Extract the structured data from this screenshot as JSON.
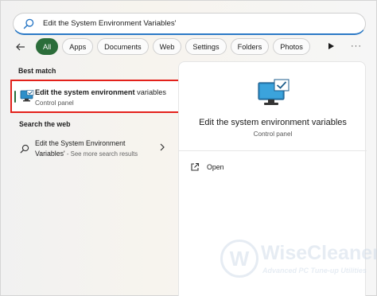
{
  "search": {
    "query": "Edit the System Environment Variables'"
  },
  "filters": {
    "items": [
      "All",
      "Apps",
      "Documents",
      "Web",
      "Settings",
      "Folders",
      "Photos"
    ],
    "active": "All"
  },
  "sections": {
    "best_match_label": "Best match",
    "search_web_label": "Search the web"
  },
  "best_match": {
    "title_bold": "Edit the system environment",
    "title_rest": " variables",
    "subtitle": "Control panel"
  },
  "web_result": {
    "line1": "Edit the System Environment",
    "line2": "Variables'",
    "see_more": " - See more search results"
  },
  "preview": {
    "title": "Edit the system environment variables",
    "subtitle": "Control panel",
    "open_label": "Open"
  },
  "watermark": {
    "brand": "WiseCleaner",
    "tagline": "Advanced PC Tune-up Utilities"
  },
  "colors": {
    "accent_green": "#2b6d3a",
    "highlight_red": "#e3211b",
    "search_underline": "#2b79c6"
  }
}
